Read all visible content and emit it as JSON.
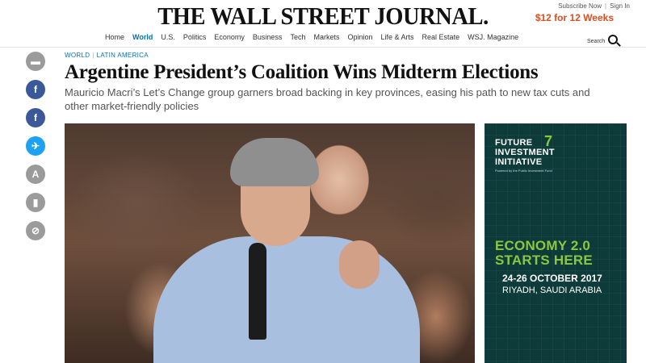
{
  "header": {
    "logo": "THE WALL STREET JOURNAL.",
    "subscribe": "Subscribe Now",
    "signin": "Sign In",
    "promo": "$12 for 12 Weeks",
    "search_label": "Search"
  },
  "nav": {
    "items": [
      {
        "label": "Home"
      },
      {
        "label": "World",
        "active": true
      },
      {
        "label": "U.S."
      },
      {
        "label": "Politics"
      },
      {
        "label": "Economy"
      },
      {
        "label": "Business"
      },
      {
        "label": "Tech"
      },
      {
        "label": "Markets"
      },
      {
        "label": "Opinion"
      },
      {
        "label": "Life & Arts"
      },
      {
        "label": "Real Estate"
      },
      {
        "label": "WSJ. Magazine"
      }
    ]
  },
  "share": [
    "comment-icon",
    "facebook-icon",
    "facebook-icon",
    "twitter-icon",
    "text-size-icon",
    "bookmark-icon",
    "link-icon"
  ],
  "article": {
    "kicker_section": "WORLD",
    "kicker_subsection": "LATIN AMERICA",
    "headline": "Argentine President’s Coalition Wins Midterm Elections",
    "dek": "Mauricio Macri’s Let’s Change group garners broad backing in key provinces, easing his path to new tax cuts and other market-friendly policies"
  },
  "ad": {
    "brand_line1": "FUTURE",
    "brand_line2": "INVESTMENT",
    "brand_line3": "INITIATIVE",
    "brand_sub": "Powered by the Public Investment Fund",
    "headline_line1": "ECONOMY 2.0",
    "headline_line2": "STARTS HERE",
    "date": "24-26 OCTOBER 2017",
    "place": "RIYADH, SAUDI ARABIA"
  }
}
